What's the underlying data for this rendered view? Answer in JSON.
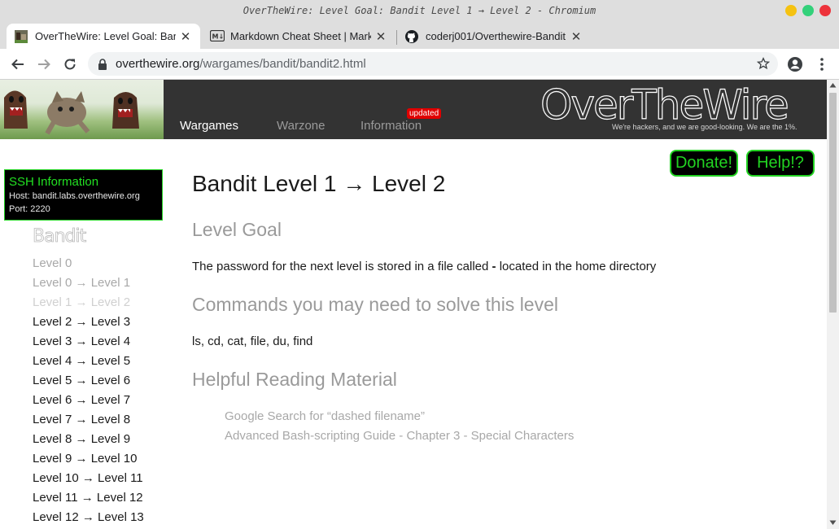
{
  "window": {
    "title": "OverTheWire: Level Goal: Bandit Level 1 → Level 2 - Chromium"
  },
  "tabs": [
    {
      "label": "OverTheWire: Level Goal: Bandit Level 1 → Level 2",
      "icon": "otw-favicon",
      "active": true
    },
    {
      "label": "Markdown Cheat Sheet | Markdown Guide",
      "icon": "markdown-icon",
      "active": false
    },
    {
      "label": "coderj001/Overthewire-Bandit",
      "icon": "github-icon",
      "active": false
    }
  ],
  "address": {
    "host": "overthewire.org",
    "path": "/wargames/bandit/bandit2.html"
  },
  "header": {
    "nav": [
      "Wargames",
      "Warzone",
      "Information"
    ],
    "badge": "updated",
    "logo": "OverTheWire",
    "tagline": "We're hackers, and we are good-looking. We are the 1%."
  },
  "buttons": {
    "donate": "Donate!",
    "help": "Help!?"
  },
  "ssh": {
    "title": "SSH Information",
    "host": "Host: bandit.labs.overthewire.org",
    "port": "Port: 2220"
  },
  "sidebar": {
    "logo": "Bandit",
    "levels": [
      {
        "label": "Level 0",
        "state": "visited"
      },
      {
        "label": "Level 0 → Level 1",
        "state": "visited"
      },
      {
        "label": "Level 1 → Level 2",
        "state": "current"
      },
      {
        "label": "Level 2 → Level 3",
        "state": "normal"
      },
      {
        "label": "Level 3 → Level 4",
        "state": "normal"
      },
      {
        "label": "Level 4 → Level 5",
        "state": "normal"
      },
      {
        "label": "Level 5 → Level 6",
        "state": "normal"
      },
      {
        "label": "Level 6 → Level 7",
        "state": "normal"
      },
      {
        "label": "Level 7 → Level 8",
        "state": "normal"
      },
      {
        "label": "Level 8 → Level 9",
        "state": "normal"
      },
      {
        "label": "Level 9 → Level 10",
        "state": "normal"
      },
      {
        "label": "Level 10 → Level 11",
        "state": "normal"
      },
      {
        "label": "Level 11 → Level 12",
        "state": "normal"
      },
      {
        "label": "Level 12 → Level 13",
        "state": "normal"
      }
    ]
  },
  "content": {
    "title": "Bandit Level 1 → Level 2",
    "goal_heading": "Level Goal",
    "goal_text_pre": "The password for the next level is stored in a file called ",
    "goal_text_file": "-",
    "goal_text_post": " located in the home directory",
    "commands_heading": "Commands you may need to solve this level",
    "commands_text": "ls, cd, cat, file, du, find",
    "reading_heading": "Helpful Reading Material",
    "reading_links": [
      "Google Search for “dashed filename”",
      "Advanced Bash-scripting Guide - Chapter 3 - Special Characters"
    ]
  },
  "colors": {
    "header_bg": "#333333",
    "accent_green": "#22d322",
    "nav_active": "#ffffff",
    "nav_inactive": "#9a9a9a",
    "link_visited": "#a8a8a8",
    "link_current": "#d0d0d0",
    "badge_red": "#e00000"
  }
}
